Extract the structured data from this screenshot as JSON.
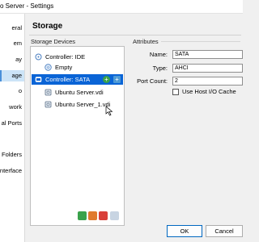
{
  "window": {
    "title": "o Server - Settings"
  },
  "sidebar": {
    "items": [
      {
        "label": "eral"
      },
      {
        "label": "em"
      },
      {
        "label": "ay"
      },
      {
        "label": "age"
      },
      {
        "label": "o"
      },
      {
        "label": "work"
      },
      {
        "label": "al Ports"
      },
      {
        "label": ""
      },
      {
        "label": "ed Folders"
      },
      {
        "label": "Interface"
      }
    ],
    "active_index": 3
  },
  "page_title": "Storage",
  "storage_devices": {
    "label": "Storage Devices",
    "tree": [
      {
        "label": "Controller: IDE",
        "kind": "controller",
        "icon": "ide-controller-icon"
      },
      {
        "label": "Empty",
        "kind": "optical",
        "icon": "optical-disc-icon"
      },
      {
        "label": "Controller: SATA",
        "kind": "controller",
        "icon": "sata-controller-icon",
        "selected": true
      },
      {
        "label": "Ubuntu Server.vdi",
        "kind": "disk",
        "icon": "hard-disk-icon"
      },
      {
        "label": "Ubuntu Server_1.vdi",
        "kind": "disk",
        "icon": "hard-disk-icon"
      }
    ],
    "toolbar_icons": [
      "add-controller-icon",
      "add-attachment-icon",
      "remove-attachment-icon",
      "controller-settings-icon"
    ]
  },
  "attributes": {
    "label": "Attributes",
    "name_label": "Name:",
    "name_value": "SATA",
    "type_label": "Type:",
    "type_value": "AHCI",
    "port_count_label": "Port Count:",
    "port_count_value": "2",
    "use_host_io_cache_label": "Use Host I/O Cache",
    "use_host_io_cache": false
  },
  "buttons": {
    "ok": "OK",
    "cancel": "Cancel"
  },
  "colors": {
    "selection": "#0a64d6",
    "accent": "#0067c0"
  }
}
